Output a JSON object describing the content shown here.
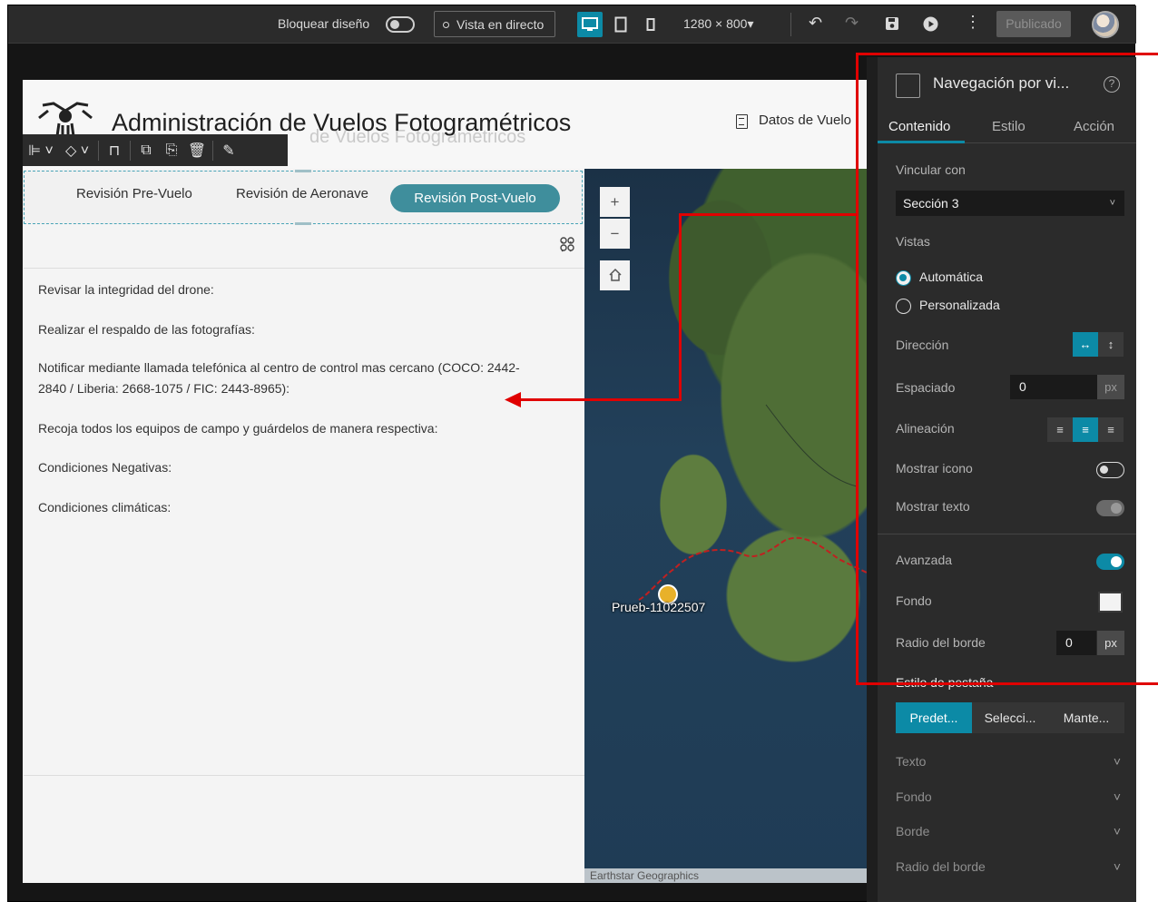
{
  "toolbar": {
    "lock_layout_label": "Bloquear diseño",
    "live_view_label": "Vista en directo",
    "resolution": "1280 × 800▾",
    "published_label": "Publicado"
  },
  "header": {
    "title": "Administración de Vuelos Fotogramétricos",
    "title_ghost": "de Vuelos Fotogramétricos",
    "datos_label": "Datos de Vuelo"
  },
  "tabs": [
    {
      "label": "Revisión Pre-Vuelo",
      "active": false
    },
    {
      "label": "Revisión de Aeronave",
      "active": false
    },
    {
      "label": "Revisión Post-Vuelo",
      "active": true
    }
  ],
  "content_lines": [
    "Revisar la integridad del drone:",
    "Realizar el respaldo de las fotografías:",
    "Notificar mediante llamada telefónica al centro de control mas cercano (COCO: 2442-",
    "2840 / Liberia: 2668-1075 / FIC: 2443-8965):",
    "Recoja todos los equipos de campo y guárdelos de manera respectiva:",
    "Condiciones Negativas:",
    "Condiciones climáticas:"
  ],
  "map": {
    "zoom_in": "+",
    "zoom_out": "−",
    "marker_label": "Prueb-11022507",
    "attribution": "Earthstar Geographics"
  },
  "panel": {
    "title": "Navegación por vi...",
    "tabs": [
      "Contenido",
      "Estilo",
      "Acción"
    ],
    "link_label": "Vincular con",
    "link_value": "Sección 3",
    "views_label": "Vistas",
    "view_auto": "Automática",
    "view_custom": "Personalizada",
    "direction_label": "Dirección",
    "spacing_label": "Espaciado",
    "spacing_value": "0",
    "unit_px": "px",
    "align_label": "Alineación",
    "show_icon_label": "Mostrar icono",
    "show_text_label": "Mostrar texto",
    "advanced_label": "Avanzada",
    "background_label": "Fondo",
    "radius_label": "Radio del borde",
    "radius_value": "0",
    "tab_style_label": "Estilo de pestaña",
    "tab_style_options": [
      "Predet...",
      "Selecci...",
      "Mante..."
    ],
    "accordions": [
      "Texto",
      "Fondo",
      "Borde",
      "Radio del borde"
    ]
  },
  "colors": {
    "accent": "#0c8aa6",
    "active_tab": "#3f8e9c",
    "annotation": "#e00000"
  }
}
